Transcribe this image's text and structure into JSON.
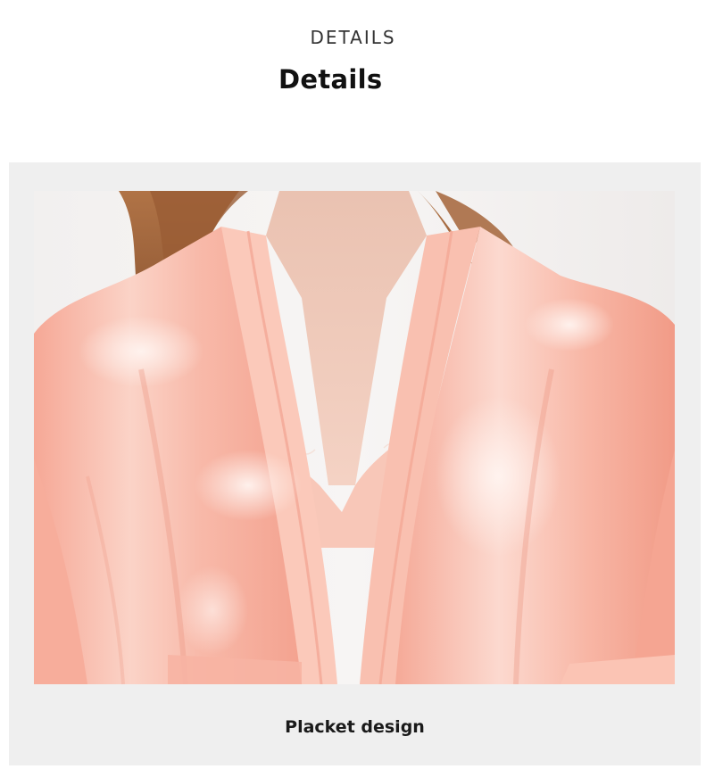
{
  "header": {
    "kicker": "DETAILS",
    "title": "Details"
  },
  "product": {
    "caption": "Placket design"
  },
  "colors": {
    "robe": "#f7b0a0",
    "robe_highlight": "#fde4dc",
    "hair": "#a0643c",
    "skin": "#f0cbbb",
    "panel_bg": "#efefef"
  }
}
